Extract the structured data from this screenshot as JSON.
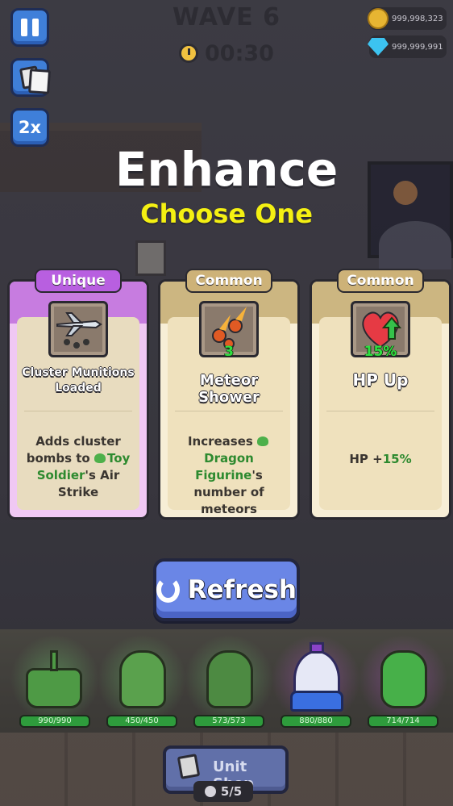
{
  "hud": {
    "wave_label": "WAVE 6",
    "timer": "00:30",
    "speed_label": "2x",
    "coins": "999,998,323",
    "gems": "999,999,991"
  },
  "header": {
    "title": "Enhance",
    "subtitle": "Choose One"
  },
  "cards": [
    {
      "rarity": "Unique",
      "name": "Cluster Munitions Loaded",
      "icon": "bomber-plane-icon",
      "desc_parts": [
        "Adds cluster bombs to ",
        "Toy Soldier",
        "'s Air Strike"
      ]
    },
    {
      "rarity": "Common",
      "name": "Meteor Shower",
      "icon": "meteor-icon",
      "badge": "3",
      "desc_parts": [
        "Increases ",
        "Dragon Figurine",
        "'s number of meteors"
      ]
    },
    {
      "rarity": "Common",
      "name": "HP Up",
      "icon": "heart-up-icon",
      "badge": "15%",
      "desc_parts": [
        "HP +",
        "15%",
        ""
      ]
    }
  ],
  "refresh_label": "Refresh",
  "units": [
    {
      "icon": "tank-unit-icon",
      "hp": "990/990"
    },
    {
      "icon": "soldier-unit-icon",
      "hp": "450/450"
    },
    {
      "icon": "commando-unit-icon",
      "hp": "573/573"
    },
    {
      "icon": "gumball-machine-unit-icon",
      "hp": "880/880"
    },
    {
      "icon": "dragon-unit-icon",
      "hp": "714/714"
    }
  ],
  "unit_shop": {
    "label": "Unit Shop",
    "count": "5/5"
  },
  "colors": {
    "unique": "#c77ce0",
    "common": "#ccb681",
    "highlight_green": "#2d8a2f",
    "subtitle_yellow": "#f4f012",
    "refresh_blue": "#6a86e6"
  }
}
